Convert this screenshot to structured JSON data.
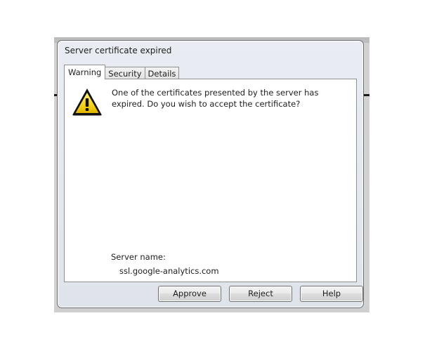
{
  "dialog": {
    "title": "Server certificate expired",
    "tabs": [
      {
        "label": "Warning",
        "active": true
      },
      {
        "label": "Security",
        "active": false
      },
      {
        "label": "Details",
        "active": false
      }
    ],
    "warning": {
      "icon": "warning-triangle-icon",
      "message": "One of the certificates presented by the server has expired. Do you wish to accept the certificate?",
      "server_name_label": "Server name:",
      "server_name_value": "ssl.google-analytics.com"
    },
    "buttons": {
      "approve": "Approve",
      "reject": "Reject",
      "help": "Help"
    }
  },
  "colors": {
    "dialog_frame": "#e4e8ee",
    "warning_yellow": "#f7d518",
    "panel_bg": "#ffffff"
  }
}
